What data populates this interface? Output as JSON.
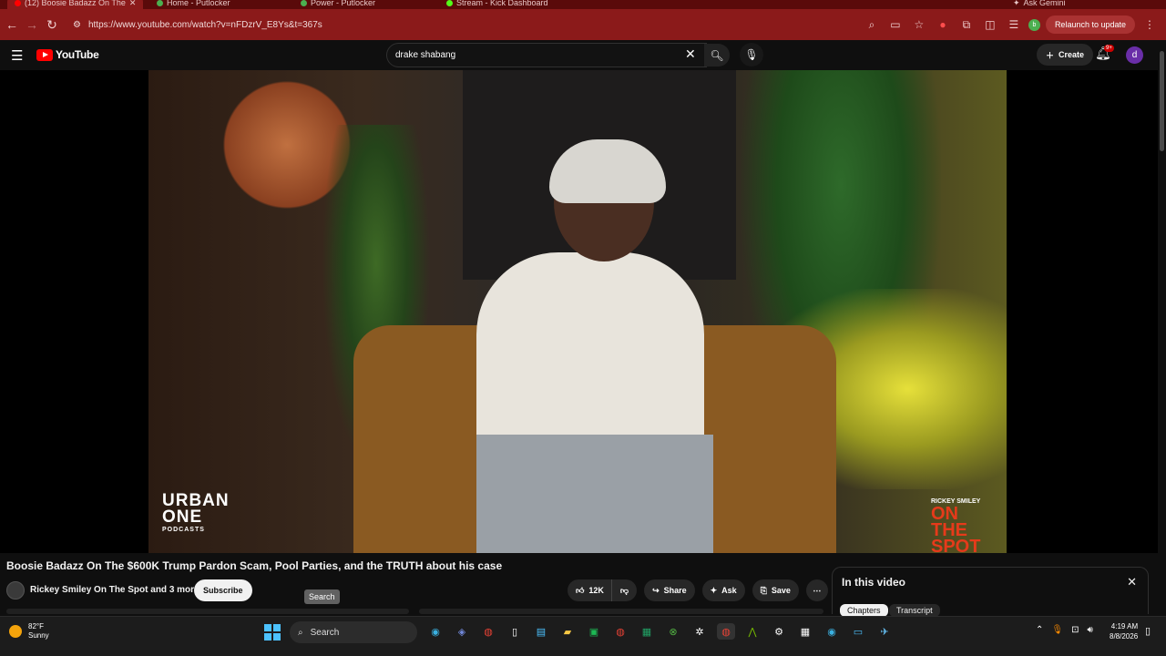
{
  "browser": {
    "tabs": [
      {
        "title": "(12) Boosie Badazz On The",
        "color": "#ff0000"
      },
      {
        "title": "Home - Putlocker",
        "color": "#4caf50"
      },
      {
        "title": "Power - Putlocker",
        "color": "#4caf50"
      },
      {
        "title": "Stream - Kick Dashboard",
        "color": "#53fc18"
      }
    ],
    "url": "https://www.youtube.com/watch?v=nFDzrV_E8Ys&t=367s",
    "ask_gemini": "Ask Gemini",
    "relaunch_label": "Relaunch to update",
    "profile_initial": "b"
  },
  "youtube": {
    "logo_text": "YouTube",
    "search_value": "drake shabang",
    "create_label": "Create",
    "notif_badge": "9+",
    "avatar_initial": "d"
  },
  "video": {
    "watermark_left_main": "URBAN ONE",
    "watermark_left_sub": "PODCASTS",
    "watermark_right_small": "RICKEY SMILEY",
    "watermark_right_main": "ON THE SPOT"
  },
  "details": {
    "title": "Boosie Badazz On The $600K Trump Pardon Scam, Pool Parties, and the TRUTH about his case",
    "channel": "Rickey Smiley On The Spot and 3 more",
    "subscribe_label": "Subscribe",
    "tooltip": "Search",
    "likes": "12K",
    "share_label": "Share",
    "ask_label": "Ask",
    "save_label": "Save"
  },
  "panel": {
    "heading": "In this video",
    "chips": [
      "Chapters",
      "Transcript"
    ]
  },
  "taskbar": {
    "temp": "82°F",
    "condition": "Sunny",
    "search_label": "Search",
    "time": "4:19 AM",
    "date": "8/8/2026"
  }
}
